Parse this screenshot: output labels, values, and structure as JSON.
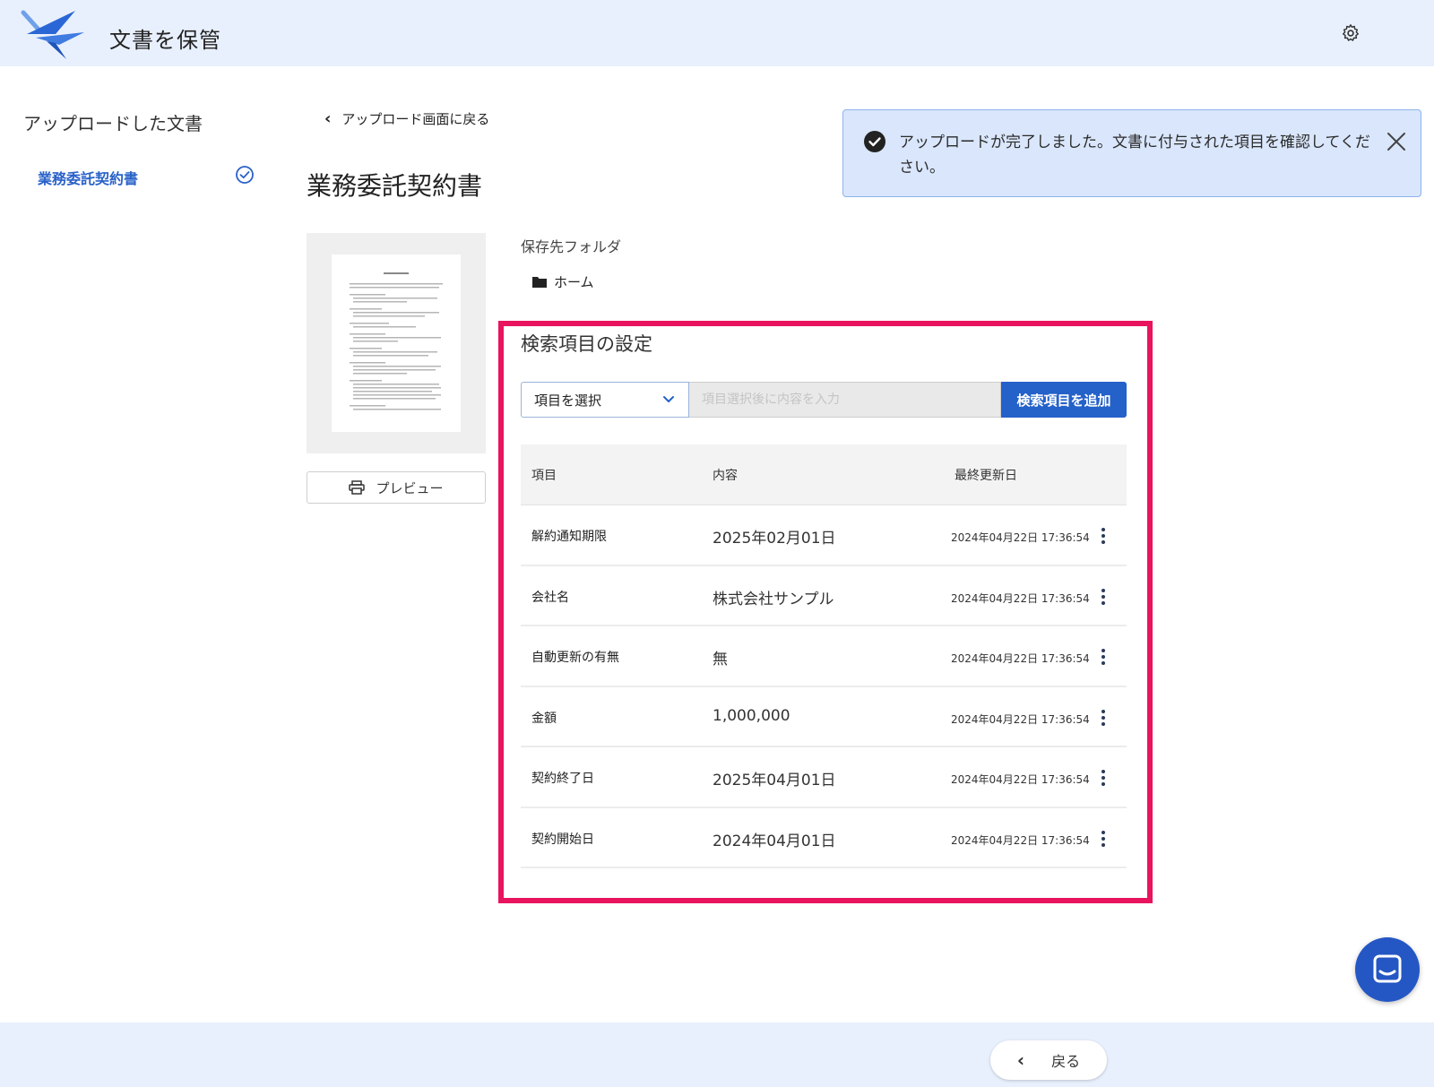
{
  "header": {
    "title": "文書を保管",
    "settings_icon": "gear-icon",
    "logo_icon": "bird-logo-icon"
  },
  "sidebar": {
    "title": "アップロードした文書",
    "items": [
      {
        "label": "業務委託契約書",
        "status_icon": "check-circle-icon"
      }
    ]
  },
  "main": {
    "back_link": "アップロード画面に戻る",
    "document_title": "業務委託契約書",
    "preview_label": "プレビュー",
    "folder": {
      "label": "保存先フォルダ",
      "value": "ホーム",
      "icon": "folder-icon"
    }
  },
  "alert": {
    "message": "アップロードが完了しました。文書に付与された項目を確認してください。",
    "icon": "check-circle-icon",
    "close_icon": "close-icon"
  },
  "search_settings": {
    "title": "検索項目の設定",
    "select": {
      "value": "項目を選択"
    },
    "input": {
      "placeholder": "項目選択後に内容を入力"
    },
    "add_button": "検索項目を追加",
    "columns": {
      "name": "項目",
      "value": "内容",
      "updated": "最終更新日"
    },
    "rows": [
      {
        "name": "解約通知期限",
        "value": "2025年02月01日",
        "updated": "2024年04月22日 17:36:54"
      },
      {
        "name": "会社名",
        "value": "株式会社サンプル",
        "updated": "2024年04月22日 17:36:54"
      },
      {
        "name": "自動更新の有無",
        "value": "無",
        "updated": "2024年04月22日 17:36:54"
      },
      {
        "name": "金額",
        "value": "1,000,000",
        "updated": "2024年04月22日 17:36:54"
      },
      {
        "name": "契約終了日",
        "value": "2025年04月01日",
        "updated": "2024年04月22日 17:36:54"
      },
      {
        "name": "契約開始日",
        "value": "2024年04月01日",
        "updated": "2024年04月22日 17:36:54"
      }
    ]
  },
  "footer": {
    "back_label": "戻る"
  },
  "colors": {
    "accent": "#2461c9",
    "highlight": "#e8145e",
    "header_bg": "#e8f0fd",
    "alert_bg": "#d9e6fb"
  }
}
